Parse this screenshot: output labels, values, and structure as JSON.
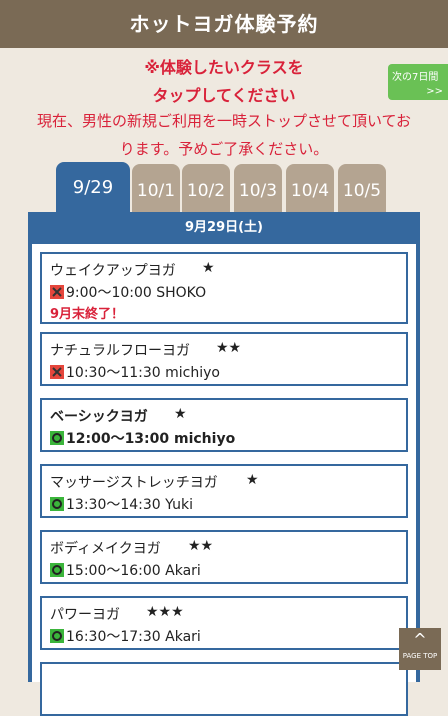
{
  "header": {
    "title": "ホットヨガ体験予約"
  },
  "notice": {
    "line1": "※体験したいクラスを",
    "line2": "タップしてください",
    "line3": "現在、男性の新規ご利用を一時ストップさせて頂いてお",
    "line4": "ります。予めご了承ください。"
  },
  "next_button": {
    "label": "次の7日間",
    "arrow": ">>"
  },
  "tabs": [
    {
      "label": "9/29"
    },
    {
      "label": "10/1"
    },
    {
      "label": "10/2"
    },
    {
      "label": "10/3"
    },
    {
      "label": "10/4"
    },
    {
      "label": "10/5"
    }
  ],
  "date_heading": "9月29日(土)",
  "classes": [
    {
      "name": "ウェイクアップヨガ",
      "stars": "★",
      "time": "9:00〜10:00 SHOKO",
      "status": "full",
      "note": "9月末終了！"
    },
    {
      "name": "ナチュラルフローヨガ",
      "stars": "★★",
      "time": "10:30〜11:30 michiyo",
      "status": "full",
      "note": ""
    },
    {
      "name": "ベーシックヨガ",
      "stars": "★",
      "time": "12:00〜13:00 michiyo",
      "status": "available",
      "note": ""
    },
    {
      "name": "マッサージストレッチヨガ",
      "stars": "★",
      "time": "13:30〜14:30 Yuki",
      "status": "available",
      "note": ""
    },
    {
      "name": "ボディメイクヨガ",
      "stars": "★★",
      "time": "15:00〜16:00 Akari",
      "status": "available",
      "note": ""
    },
    {
      "name": "パワーヨガ",
      "stars": "★★★",
      "time": "16:30〜17:30 Akari",
      "status": "available",
      "note": ""
    }
  ],
  "page_top": {
    "arrow": "^",
    "label": "PAGE TOP"
  },
  "colors": {
    "header": "#7a6a55",
    "accent_blue": "#35689e",
    "tab_inactive": "#b4a491",
    "notice_red": "#d9223a",
    "next_green": "#6ac155",
    "available_green": "#3bb53b",
    "full_red": "#e5463c"
  }
}
